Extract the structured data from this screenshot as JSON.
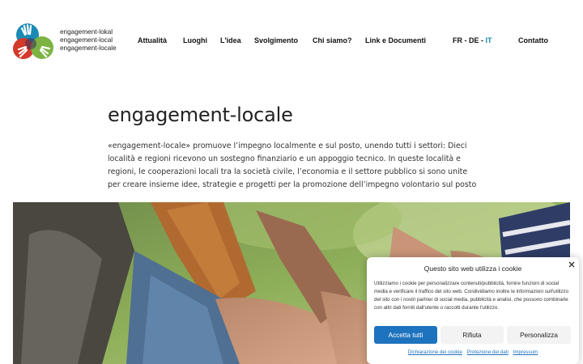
{
  "logo": {
    "lines": [
      "engagement-lokal",
      "engagement-local",
      "engagement-locale"
    ],
    "colors": [
      "#1a8bb4",
      "#d33a2c",
      "#7cb342"
    ]
  },
  "nav": {
    "items": [
      "Attualità",
      "Luoghi",
      "L'idea",
      "Svolgimento",
      "Chi siamo?",
      "Link e Documenti"
    ],
    "contact": "Contatto"
  },
  "languages": {
    "fr": "FR",
    "sep1": " - ",
    "de": "DE",
    "sep2": " - ",
    "it": "IT",
    "active_color": "#1a8bb4"
  },
  "main": {
    "title": "engagement-locale",
    "intro": "«engagement-locale» promuove l’impegno localmente e sul posto, unendo tutti i settori: Dieci località e regioni ricevono un sostegno finanziario e un appoggio tecnico. In queste località e regioni, le cooperazioni locali tra la società civile, l’economia e il settore pubblico si sono unite per creare insieme idee, strategie e progetti per la promozione dell’impegno volontario sul posto"
  },
  "cookie": {
    "title": "Questo sito web utilizza i cookie",
    "text": "Utilizziamo i cookie per personalizzare contenuti/pubblicità, fornire funzioni di social media e verificare il traffico del sito web. Condividiamo inoltre le informazioni sull'utilizzo del sito con i nostri partner di social media, pubblicità e analisi, che possono combinarle con altri dati forniti dall'utente o raccolti durante l'utilizzo.",
    "accept": "Accetta tutti",
    "reject": "Rifiuta",
    "customize": "Personalizza",
    "links": [
      "Dichiarazione dei cookie",
      "Protezione dei dati",
      "Impressum"
    ],
    "accent": "#1e73be"
  }
}
